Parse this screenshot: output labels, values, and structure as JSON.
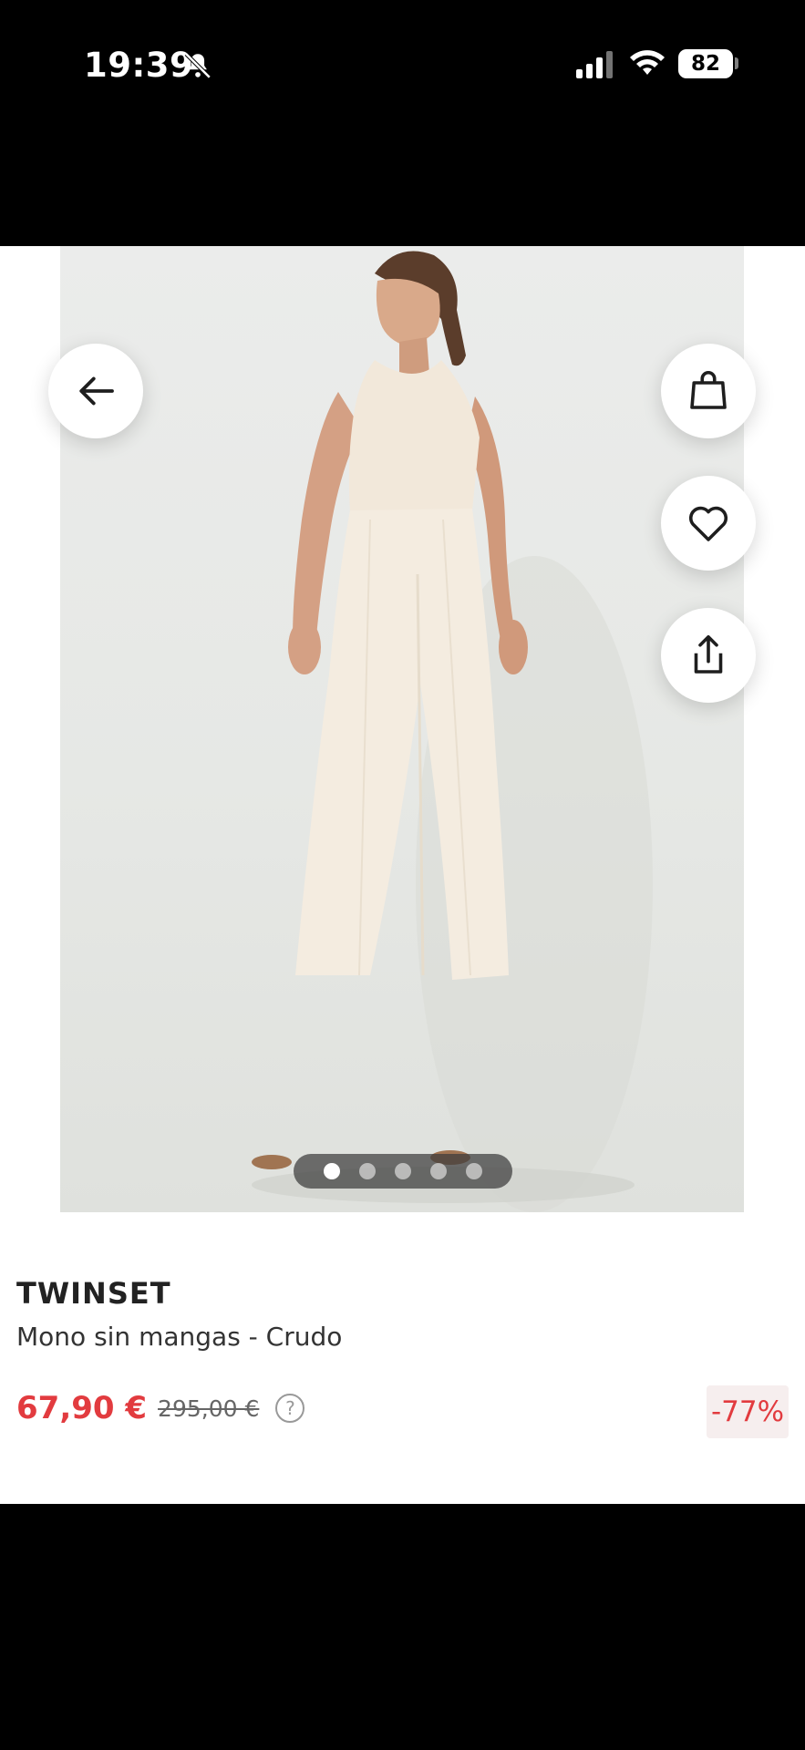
{
  "status_bar": {
    "time": "19:39",
    "battery": "82",
    "icons": [
      "bell-slash-icon",
      "signal-icon",
      "wifi-icon",
      "battery-icon"
    ]
  },
  "product_image": {
    "carousel": {
      "total": 5,
      "active_index": 0
    }
  },
  "actions": {
    "back_icon": "arrow-left-icon",
    "bag_icon": "shopping-bag-icon",
    "favorite_icon": "heart-icon",
    "share_icon": "share-icon"
  },
  "product": {
    "brand": "TWINSET",
    "name": "Mono sin mangas - Crudo",
    "price_current": "67,90 €",
    "price_old": "295,00 €",
    "help_icon": "question-circle-icon",
    "discount": "-77%"
  },
  "colors": {
    "price_accent": "#e23b3f",
    "discount_bg": "#f6eeee"
  }
}
